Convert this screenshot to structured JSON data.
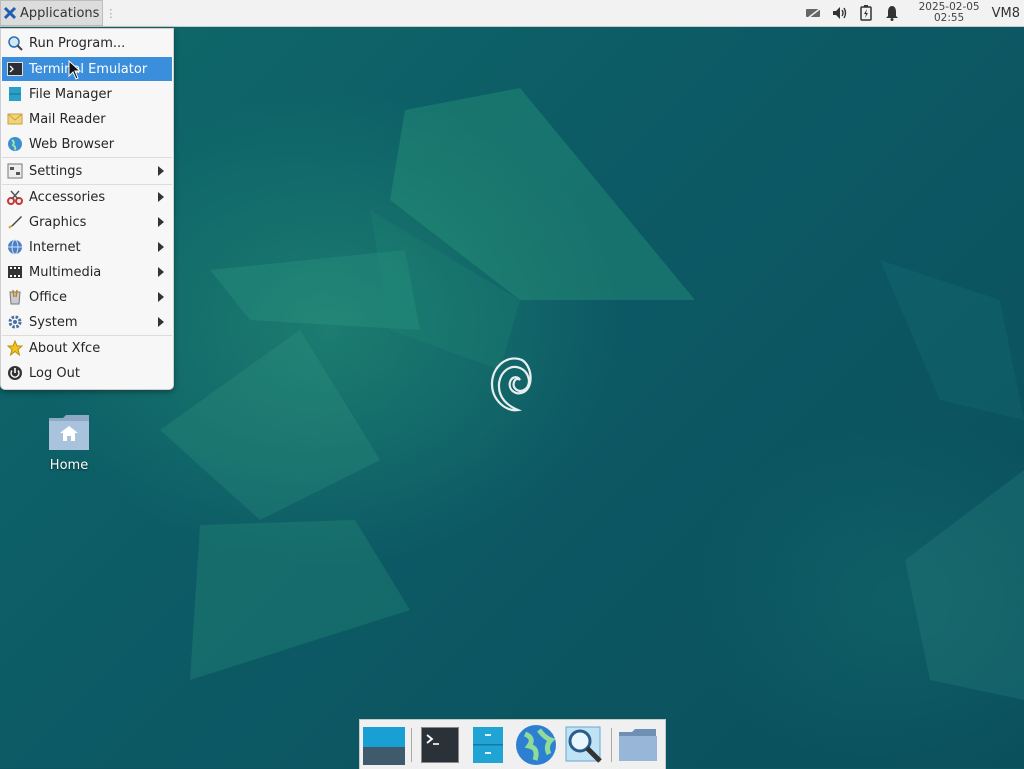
{
  "panel": {
    "applications_label": "Applications",
    "clock_date": "2025-02-05",
    "clock_time": "02:55",
    "vm_label": "VM8",
    "tray_icons": [
      "network-icon",
      "volume-icon",
      "battery-icon",
      "notification-bell-icon"
    ]
  },
  "menu": {
    "items": [
      {
        "label": "Run Program...",
        "icon": "run-program-icon",
        "submenu": false
      },
      {
        "label": "Terminal Emulator",
        "icon": "terminal-icon",
        "submenu": false,
        "highlighted": true
      },
      {
        "label": "File Manager",
        "icon": "file-manager-icon",
        "submenu": false
      },
      {
        "label": "Mail Reader",
        "icon": "mail-icon",
        "submenu": false
      },
      {
        "label": "Web Browser",
        "icon": "web-browser-icon",
        "submenu": false
      },
      {
        "label": "Settings",
        "icon": "settings-icon",
        "submenu": true
      },
      {
        "label": "Accessories",
        "icon": "accessories-icon",
        "submenu": true
      },
      {
        "label": "Graphics",
        "icon": "graphics-icon",
        "submenu": true
      },
      {
        "label": "Internet",
        "icon": "internet-icon",
        "submenu": true
      },
      {
        "label": "Multimedia",
        "icon": "multimedia-icon",
        "submenu": true
      },
      {
        "label": "Office",
        "icon": "office-icon",
        "submenu": true
      },
      {
        "label": "System",
        "icon": "system-icon",
        "submenu": true
      },
      {
        "label": "About Xfce",
        "icon": "about-star-icon",
        "submenu": false
      },
      {
        "label": "Log Out",
        "icon": "log-out-icon",
        "submenu": false
      }
    ]
  },
  "desktop": {
    "home_label": "Home"
  },
  "dock": {
    "items": [
      "show-desktop-icon",
      "terminal-icon",
      "file-manager-icon",
      "web-browser-icon",
      "app-finder-icon",
      "folder-icon"
    ]
  },
  "colors": {
    "menu_highlight": "#3a8edb",
    "desktop_bg": "#0d5560",
    "panel_bg": "#f2f2f2"
  }
}
